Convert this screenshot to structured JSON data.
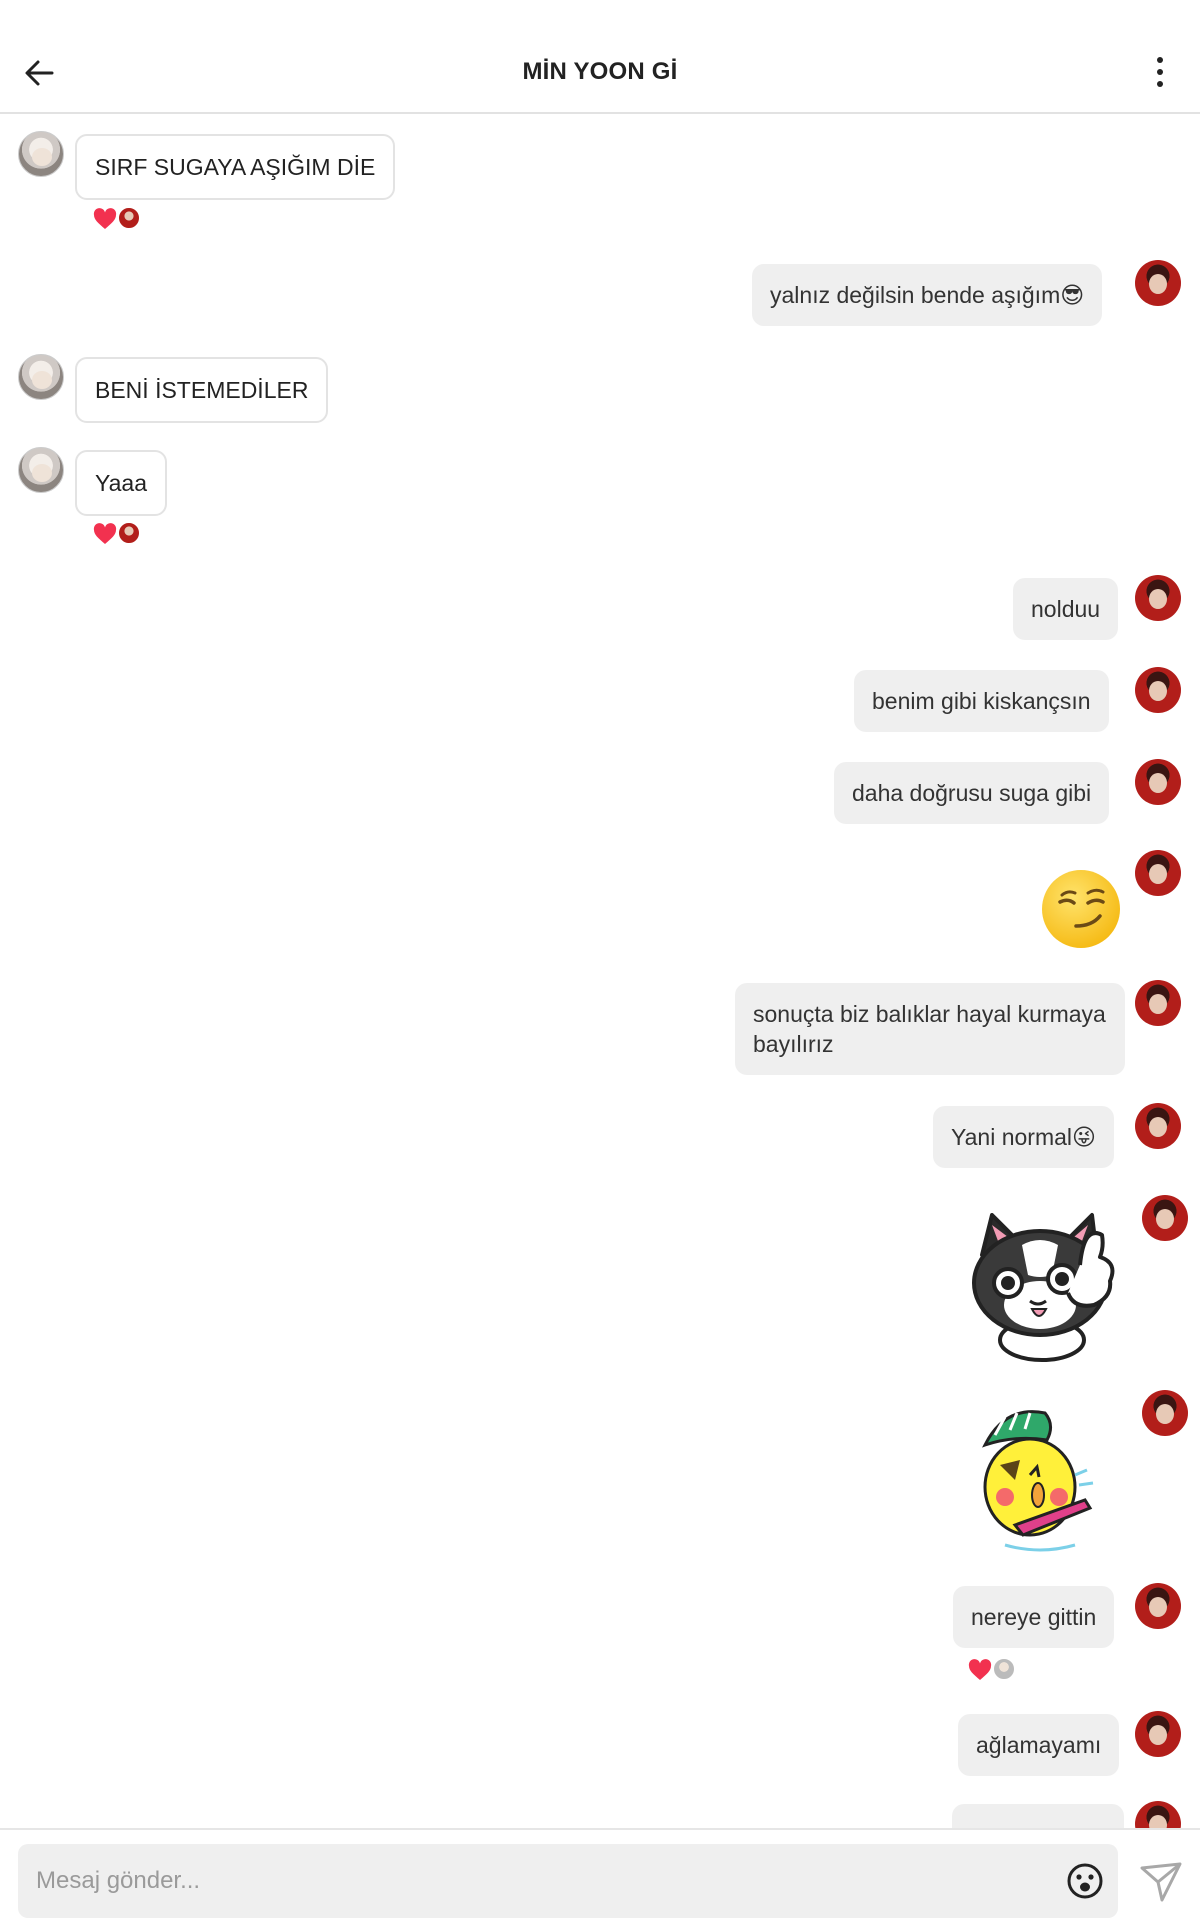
{
  "header": {
    "title": "MİN YOON Gİ"
  },
  "messages": [
    {
      "text": "SIRF SUGAYA AŞIĞIM DİE"
    },
    {
      "text": "yalnız değilsin bende aşığım😎"
    },
    {
      "text": "BENİ İSTEMEDİLER"
    },
    {
      "text": "Yaaa"
    },
    {
      "text": "nolduu"
    },
    {
      "text": "benim gibi kiskançsın"
    },
    {
      "text": "daha doğrusu suga gibi"
    },
    {
      "text": "😏"
    },
    {
      "text": "sonuçta biz balıklar hayal kurmaya bayılırız"
    },
    {
      "text": "Yani normal😜"
    },
    {
      "text": "nereye gittin"
    },
    {
      "text": "ağlamayamı"
    }
  ],
  "stickers": [
    {
      "name": "black-white-cat-thumbs-up"
    },
    {
      "name": "yellow-chick-guitar"
    }
  ],
  "composer": {
    "placeholder": "Mesaj gönder..."
  },
  "colors": {
    "heart": "#f2314f",
    "bubble_out": "#efefef",
    "bubble_in_border": "#e3e3e3"
  }
}
